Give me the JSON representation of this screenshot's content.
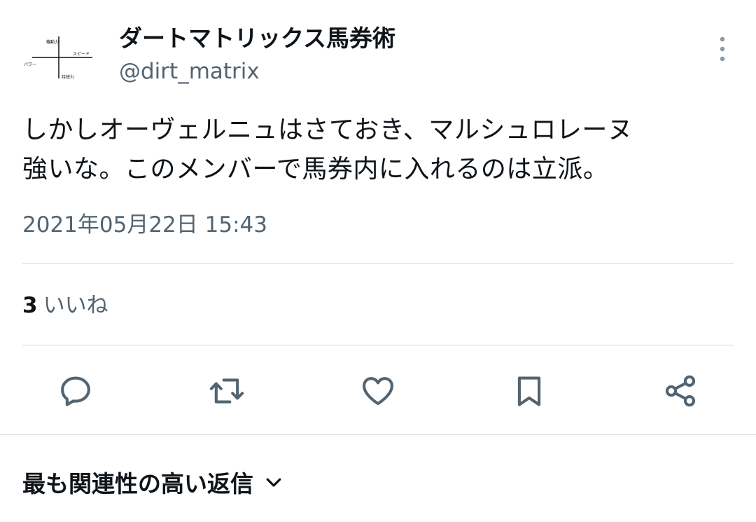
{
  "tweet": {
    "author": {
      "display_name": "ダートマトリックス馬券術",
      "handle": "@dirt_matrix",
      "avatar": {
        "icon": "axis-cross-diagram",
        "labels": {
          "top": "機動力",
          "right": "スピード",
          "left": "パワー",
          "bottom": "持続力"
        }
      }
    },
    "text": "しかしオーヴェルニュはさておき、マルシュロレーヌ\n強いな。このメンバーで馬券内に入れるのは立派。",
    "timestamp": "2021年05月22日 15:43",
    "likes": {
      "count": "3",
      "label": "いいね"
    },
    "actions": [
      {
        "name": "reply",
        "icon": "reply-icon"
      },
      {
        "name": "retweet",
        "icon": "retweet-icon"
      },
      {
        "name": "like",
        "icon": "heart-icon"
      },
      {
        "name": "bookmark",
        "icon": "bookmark-icon"
      },
      {
        "name": "share",
        "icon": "share-icon"
      }
    ]
  },
  "replies_sort": {
    "label": "最も関連性の高い返信",
    "icon": "chevron-down-icon"
  },
  "colors": {
    "text_primary": "#0f1419",
    "text_secondary": "#536471",
    "divider": "#d4dadf"
  }
}
